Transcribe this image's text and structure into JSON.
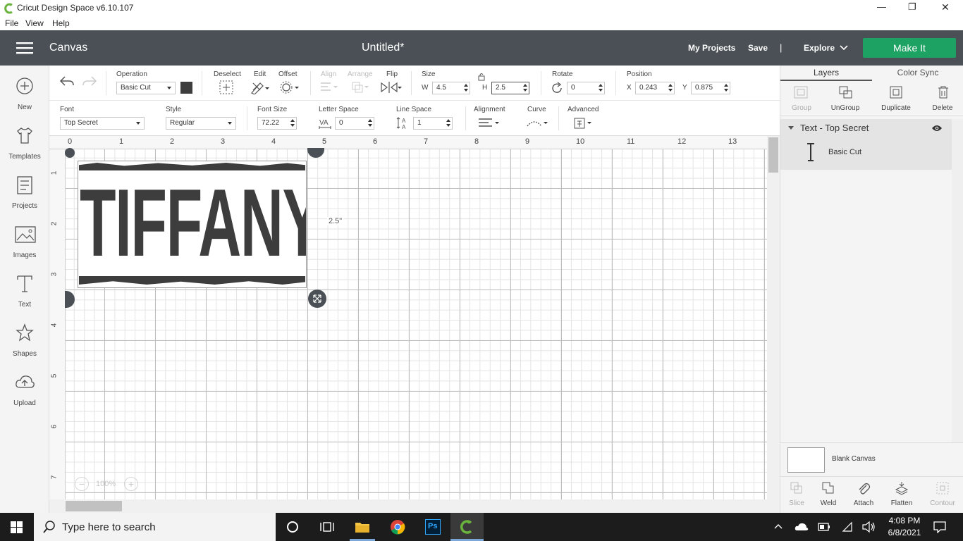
{
  "window": {
    "title": "Cricut Design Space  v6.10.107",
    "minimize": "—",
    "maximize": "❐",
    "close": "✕"
  },
  "menu": [
    "File",
    "View",
    "Help"
  ],
  "header": {
    "section": "Canvas",
    "doc_title": "Untitled*",
    "my_projects": "My Projects",
    "save": "Save",
    "divider": "|",
    "explore": "Explore",
    "make_it": "Make It"
  },
  "sidebar": [
    {
      "label": "New",
      "icon": "plus-circle-icon"
    },
    {
      "label": "Templates",
      "icon": "tshirt-icon"
    },
    {
      "label": "Projects",
      "icon": "projects-icon"
    },
    {
      "label": "Images",
      "icon": "image-icon"
    },
    {
      "label": "Text",
      "icon": "text-icon"
    },
    {
      "label": "Shapes",
      "icon": "shapes-icon"
    },
    {
      "label": "Upload",
      "icon": "upload-cloud-icon"
    }
  ],
  "toolbar1": {
    "operation_label": "Operation",
    "operation_value": "Basic Cut",
    "color": "#3d3d3d",
    "deselect": "Deselect",
    "edit": "Edit",
    "offset": "Offset",
    "align": "Align",
    "arrange": "Arrange",
    "flip": "Flip",
    "size_label": "Size",
    "w_label": "W",
    "w_value": "4.5",
    "h_label": "H",
    "h_value": "2.5",
    "rotate_label": "Rotate",
    "rotate_value": "0",
    "position_label": "Position",
    "x_label": "X",
    "x_value": "0.243",
    "y_label": "Y",
    "y_value": "0.875"
  },
  "toolbar2": {
    "font_label": "Font",
    "font_value": "Top Secret",
    "style_label": "Style",
    "style_value": "Regular",
    "font_size_label": "Font Size",
    "font_size_value": "72.22",
    "letter_space_label": "Letter Space",
    "letter_space_value": "0",
    "line_space_label": "Line Space",
    "line_space_value": "1",
    "alignment_label": "Alignment",
    "curve_label": "Curve",
    "advanced_label": "Advanced"
  },
  "canvas": {
    "ruler_top": [
      "0",
      "1",
      "2",
      "3",
      "4",
      "5",
      "6",
      "7",
      "8",
      "9",
      "10",
      "11",
      "12",
      "13"
    ],
    "ruler_left": [
      "1",
      "2",
      "3",
      "4",
      "5",
      "6",
      "7"
    ],
    "text_content": "TIFFANY",
    "height_readout": "2.5\"",
    "zoom": "100%",
    "zoom_minus": "−",
    "zoom_plus": "+"
  },
  "right_panel": {
    "tabs": [
      "Layers",
      "Color Sync"
    ],
    "actions": [
      {
        "label": "Group",
        "enabled": false
      },
      {
        "label": "UnGroup",
        "enabled": true
      },
      {
        "label": "Duplicate",
        "enabled": true
      },
      {
        "label": "Delete",
        "enabled": true
      }
    ],
    "layer_group": "Text - Top Secret",
    "layer_item": "Basic Cut",
    "blank_canvas": "Blank Canvas",
    "bottom_actions": [
      {
        "label": "Slice",
        "enabled": false
      },
      {
        "label": "Weld",
        "enabled": true
      },
      {
        "label": "Attach",
        "enabled": true
      },
      {
        "label": "Flatten",
        "enabled": true
      },
      {
        "label": "Contour",
        "enabled": false
      }
    ]
  },
  "taskbar": {
    "search_placeholder": "Type here to search",
    "time": "4:08 PM",
    "date": "6/8/2021",
    "ps": "Ps"
  },
  "colors": {
    "header": "#4a5055",
    "make_it": "#1da264",
    "object": "#3d3d3d",
    "taskbar": "#1c1c1c"
  }
}
